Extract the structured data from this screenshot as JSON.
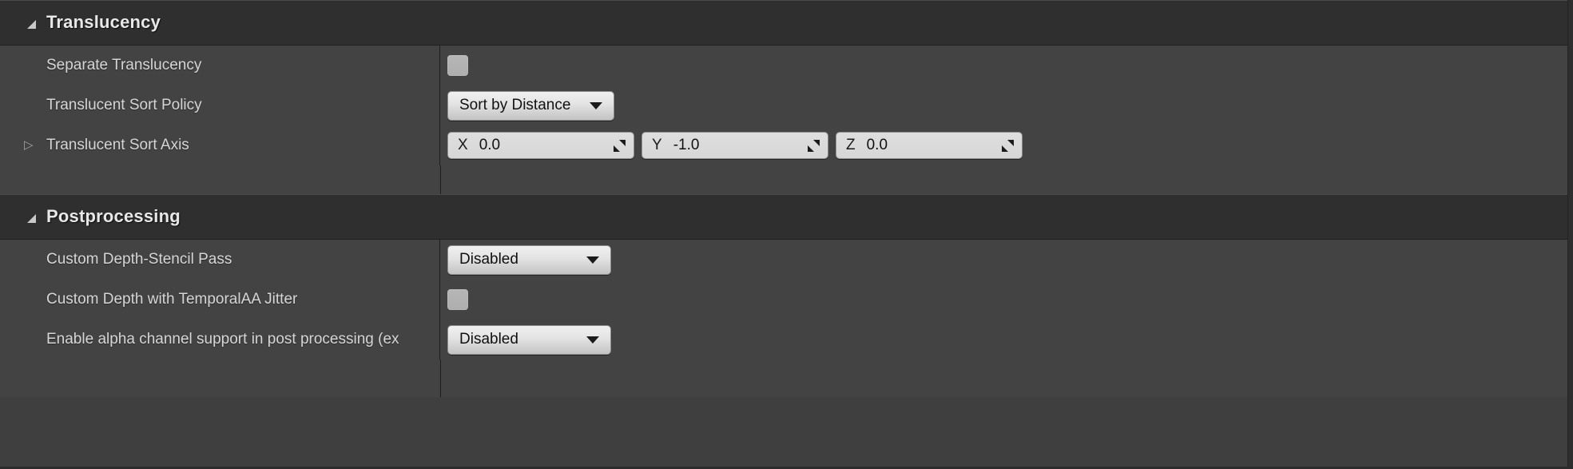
{
  "panel": {
    "sections": [
      {
        "id": "translucency",
        "title": "Translucency",
        "collapse_icon": "triangle-down-icon",
        "rows": [
          {
            "id": "separate-translucency",
            "label": "Separate Translucency",
            "expander": false,
            "control": "checkbox",
            "checked": false
          },
          {
            "id": "translucent-sort-policy",
            "label": "Translucent Sort Policy",
            "expander": false,
            "control": "combo",
            "value": "Sort by Distance",
            "chevron_icon": "chevron-down-icon"
          },
          {
            "id": "translucent-sort-axis",
            "label": "Translucent Sort Axis",
            "expander": true,
            "expander_icon": "triangle-right-icon",
            "control": "vector",
            "vector": [
              {
                "axis": "X",
                "value": "0.0",
                "grip_icon": "drag-grip-icon"
              },
              {
                "axis": "Y",
                "value": "-1.0",
                "grip_icon": "drag-grip-icon"
              },
              {
                "axis": "Z",
                "value": "0.0",
                "grip_icon": "drag-grip-icon"
              }
            ]
          }
        ]
      },
      {
        "id": "postprocessing",
        "title": "Postprocessing",
        "collapse_icon": "triangle-down-icon",
        "rows": [
          {
            "id": "custom-depth-stencil-pass",
            "label": "Custom Depth-Stencil Pass",
            "expander": false,
            "control": "combo",
            "value": "Disabled",
            "chevron_icon": "chevron-down-icon"
          },
          {
            "id": "custom-depth-temporalaa-jitter",
            "label": "Custom Depth with TemporalAA Jitter",
            "expander": false,
            "control": "checkbox",
            "checked": false
          },
          {
            "id": "enable-alpha-channel-support",
            "label": "Enable alpha channel support in post processing (ex",
            "expander": false,
            "control": "combo",
            "value": "Disabled",
            "chevron_icon": "chevron-down-icon"
          }
        ]
      }
    ]
  },
  "colors": {
    "panel_background": "#3f3f3f",
    "row_background": "#434343",
    "section_header_background": "#2f2f2f",
    "label_text": "#d6d6d6",
    "title_text": "#e8e8e8",
    "control_face": "#e4e4e4",
    "control_text": "#111111",
    "divider": "#1e1e1e"
  }
}
